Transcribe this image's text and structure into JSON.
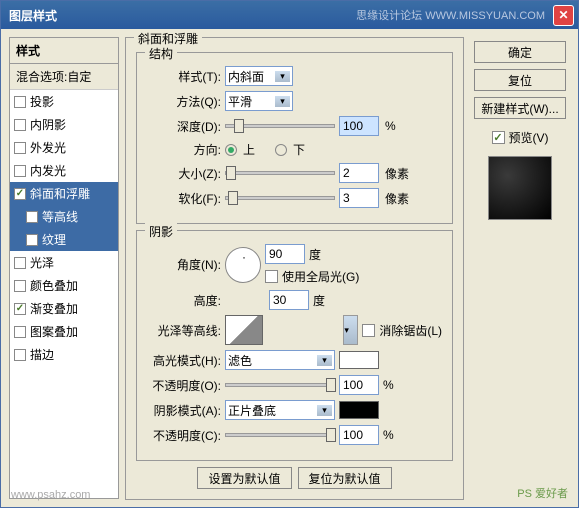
{
  "titlebar": {
    "title": "图层样式",
    "right_text": "思缘设计论坛  WWW.MISSYUAN.COM"
  },
  "sidebar": {
    "header": "样式",
    "blend_label": "混合选项:自定",
    "items": [
      {
        "label": "投影",
        "checked": false
      },
      {
        "label": "内阴影",
        "checked": false
      },
      {
        "label": "外发光",
        "checked": false
      },
      {
        "label": "内发光",
        "checked": false
      },
      {
        "label": "斜面和浮雕",
        "checked": true,
        "selected": true
      },
      {
        "label": "等高线",
        "checked": false,
        "sub": true,
        "selected": true
      },
      {
        "label": "纹理",
        "checked": false,
        "sub": true,
        "selected": true
      },
      {
        "label": "光泽",
        "checked": false
      },
      {
        "label": "颜色叠加",
        "checked": false
      },
      {
        "label": "渐变叠加",
        "checked": true
      },
      {
        "label": "图案叠加",
        "checked": false
      },
      {
        "label": "描边",
        "checked": false
      }
    ]
  },
  "main": {
    "title": "斜面和浮雕",
    "structure": {
      "legend": "结构",
      "style_label": "样式(T):",
      "style_value": "内斜面",
      "method_label": "方法(Q):",
      "method_value": "平滑",
      "depth_label": "深度(D):",
      "depth_value": "100",
      "depth_unit": "%",
      "direction_label": "方向:",
      "dir_up": "上",
      "dir_down": "下",
      "size_label": "大小(Z):",
      "size_value": "2",
      "size_unit": "像素",
      "soften_label": "软化(F):",
      "soften_value": "3",
      "soften_unit": "像素"
    },
    "shading": {
      "legend": "阴影",
      "angle_label": "角度(N):",
      "angle_value": "90",
      "angle_unit": "度",
      "global_label": "使用全局光(G)",
      "altitude_label": "高度:",
      "altitude_value": "30",
      "altitude_unit": "度",
      "contour_label": "光泽等高线:",
      "antialias_label": "消除锯齿(L)",
      "highlight_mode_label": "高光模式(H):",
      "highlight_mode_value": "滤色",
      "highlight_opacity_label": "不透明度(O):",
      "highlight_opacity_value": "100",
      "pct": "%",
      "shadow_mode_label": "阴影模式(A):",
      "shadow_mode_value": "正片叠底",
      "shadow_opacity_label": "不透明度(C):",
      "shadow_opacity_value": "100"
    },
    "buttons": {
      "default": "设置为默认值",
      "reset": "复位为默认值"
    }
  },
  "right": {
    "ok": "确定",
    "cancel": "复位",
    "new_style": "新建样式(W)...",
    "preview": "预览(V)"
  },
  "watermark": "PS 爱好者",
  "watermark2": "www.psahz.com"
}
